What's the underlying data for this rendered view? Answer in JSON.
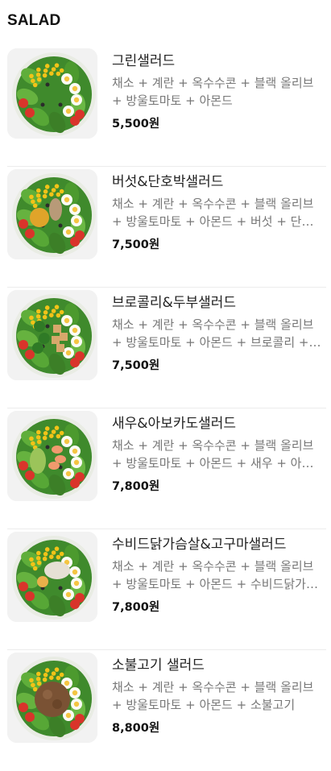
{
  "section": {
    "title": "SALAD"
  },
  "items": [
    {
      "name": "그린샐러드",
      "desc": "채소 + 계란 + 옥수수콘 + 블랙 올리브 + 방울토마토 + 아몬드",
      "price": "5,500원",
      "topping": "green"
    },
    {
      "name": "버섯&단호박샐러드",
      "desc": "채소 + 계란 + 옥수수콘 + 블랙 올리브 + 방울토마토 + 아몬드 + 버섯 + 단호박",
      "price": "7,500원",
      "topping": "mushroom"
    },
    {
      "name": "브로콜리&두부샐러드",
      "desc": "채소 + 계란 + 옥수수콘 + 블랙 올리브 + 방울토마토 + 아몬드 + 브로콜리 + 두부",
      "price": "7,500원",
      "topping": "tofu"
    },
    {
      "name": "새우&아보카도샐러드",
      "desc": "채소 + 계란 + 옥수수콘 + 블랙 올리브 + 방울토마토 + 아몬드 + 새우 + 아보카도",
      "price": "7,800원",
      "topping": "shrimp"
    },
    {
      "name": "수비드닭가슴살&고구마샐러드",
      "desc": "채소 + 계란 + 옥수수콘 + 블랙 올리브 + 방울토마토 + 아몬드 + 수비드닭가슴살 + 고구마",
      "price": "7,800원",
      "topping": "chicken"
    },
    {
      "name": "소불고기 샐러드",
      "desc": "채소 + 계란 + 옥수수콘 + 블랙 올리브 + 방울토마토 + 아몬드 + 소불고기",
      "price": "8,800원",
      "topping": "beef"
    }
  ]
}
